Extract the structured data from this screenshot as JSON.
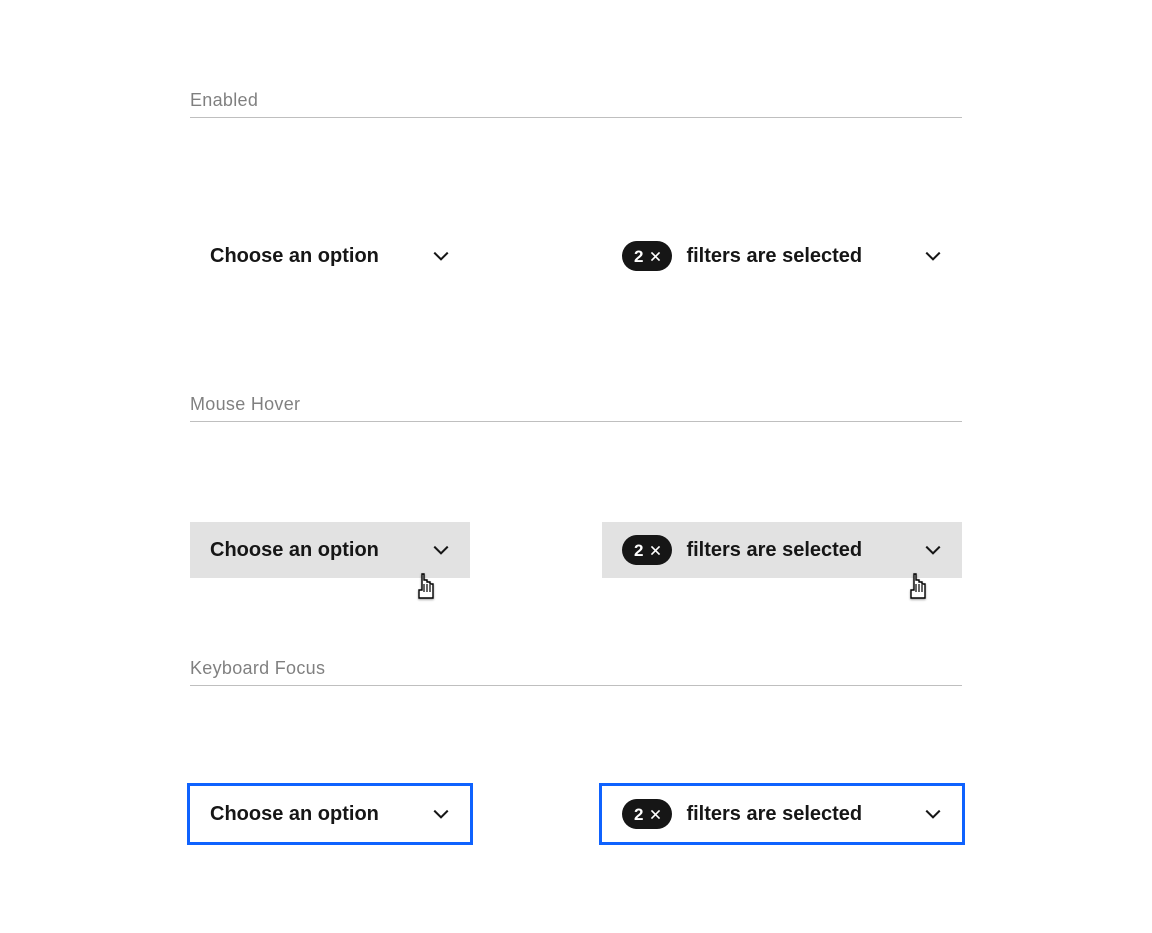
{
  "sections": {
    "enabled": {
      "title": "Enabled"
    },
    "hover": {
      "title": "Mouse Hover"
    },
    "focus": {
      "title": "Keyboard Focus"
    }
  },
  "dropdown": {
    "placeholder": "Choose an option",
    "filter_label": "filters are selected",
    "filter_count": "2"
  },
  "colors": {
    "focus_ring": "#0f62fe",
    "hover_bg": "#e2e2e2",
    "text": "#161616",
    "badge_bg": "#161616",
    "badge_fg": "#ffffff"
  }
}
